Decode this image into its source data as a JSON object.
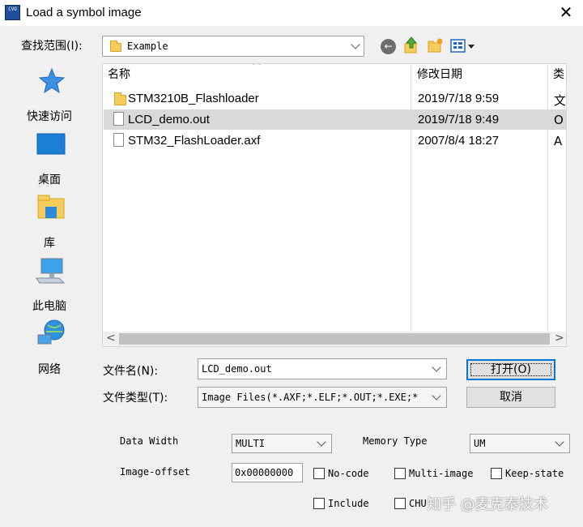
{
  "window": {
    "app_icon_text": "CVO",
    "title": "Load a symbol image",
    "close_glyph": "✕"
  },
  "lookin": {
    "label": "查找范围(I):",
    "value": "Example",
    "folder_icon": "folder-icon",
    "back_icon": "back-arrow-icon",
    "up_icon": "up-folder-icon",
    "new_folder_icon": "new-folder-icon",
    "view_icon": "view-menu-icon"
  },
  "places": [
    {
      "label": "快速访问",
      "icon": "star-icon"
    },
    {
      "label": "桌面",
      "icon": "desktop-icon"
    },
    {
      "label": "库",
      "icon": "library-icon"
    },
    {
      "label": "此电脑",
      "icon": "computer-icon"
    },
    {
      "label": "网络",
      "icon": "network-icon"
    }
  ],
  "file_list": {
    "columns": [
      "名称",
      "修改日期",
      "类"
    ],
    "sort_indicator": "^",
    "rows": [
      {
        "name": "STM3210B_Flashloader",
        "date": "2019/7/18 9:59",
        "type_partial": "文",
        "kind": "folder",
        "selected": false
      },
      {
        "name": "LCD_demo.out",
        "date": "2019/7/18 9:49",
        "type_partial": "O",
        "kind": "file",
        "selected": true
      },
      {
        "name": "STM32_FlashLoader.axf",
        "date": "2007/8/4 18:27",
        "type_partial": "A",
        "kind": "file",
        "selected": false
      }
    ],
    "scroll_left": "<",
    "scroll_right": ">"
  },
  "filename": {
    "label": "文件名(N):",
    "value": "LCD_demo.out"
  },
  "filetype": {
    "label": "文件类型(T):",
    "value": "Image Files(*.AXF;*.ELF;*.OUT;*.EXE;*"
  },
  "buttons": {
    "open": "打开(O)",
    "cancel": "取消"
  },
  "options": {
    "data_width_label": "Data Width",
    "data_width_value": "MULTI",
    "memory_type_label": "Memory Type",
    "memory_type_value": "UM",
    "image_offset_label": "Image-offset",
    "image_offset_value": "0x00000000",
    "checkboxes": [
      "No-code",
      "Multi-image",
      "Keep-state",
      "Include",
      "CHU"
    ]
  },
  "watermark": "知乎 @麦克泰技术",
  "colors": {
    "accent": "#0078d7",
    "selected_row": "#d9d9d9",
    "folder": "#f6cd5c"
  }
}
